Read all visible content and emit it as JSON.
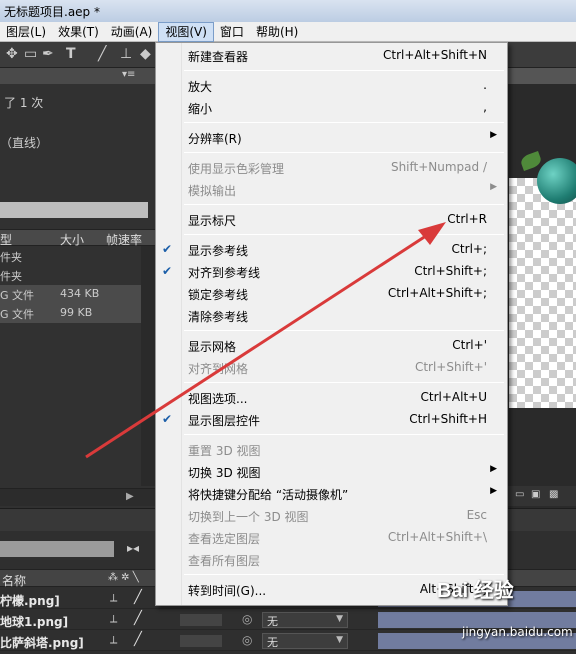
{
  "window": {
    "title": "无标题项目.aep *"
  },
  "menubar": [
    "图层(L)",
    "效果(T)",
    "动画(A)",
    "视图(V)",
    "窗口",
    "帮助(H)"
  ],
  "project": {
    "info_line1": "了 1 次",
    "info_line2": "（直线）",
    "columns": {
      "type": "型",
      "size": "大小",
      "fps": "帧速率"
    },
    "rows": [
      {
        "type": "件夹",
        "size": ""
      },
      {
        "type": "件夹",
        "size": ""
      },
      {
        "type": "G 文件",
        "size": "434 KB"
      },
      {
        "type": "G 文件",
        "size": "99 KB"
      }
    ]
  },
  "view_menu": {
    "items": [
      {
        "label": "新建查看器",
        "shortcut": "Ctrl+Alt+Shift+N",
        "disabled": false,
        "checked": false,
        "submenu": false
      },
      {
        "label": "放大",
        "shortcut": ".",
        "disabled": false,
        "checked": false,
        "submenu": false
      },
      {
        "label": "缩小",
        "shortcut": ",",
        "disabled": false,
        "checked": false,
        "submenu": false
      },
      {
        "label": "分辨率(R)",
        "shortcut": "",
        "disabled": false,
        "checked": false,
        "submenu": true
      },
      {
        "label": "使用显示色彩管理",
        "shortcut": "Shift+Numpad /",
        "disabled": true,
        "checked": false,
        "submenu": false
      },
      {
        "label": "模拟输出",
        "shortcut": "",
        "disabled": true,
        "checked": false,
        "submenu": true
      },
      {
        "label": "显示标尺",
        "shortcut": "Ctrl+R",
        "disabled": false,
        "checked": false,
        "submenu": false
      },
      {
        "label": "显示参考线",
        "shortcut": "Ctrl+;",
        "disabled": false,
        "checked": true,
        "submenu": false
      },
      {
        "label": "对齐到参考线",
        "shortcut": "Ctrl+Shift+;",
        "disabled": false,
        "checked": true,
        "submenu": false
      },
      {
        "label": "锁定参考线",
        "shortcut": "Ctrl+Alt+Shift+;",
        "disabled": false,
        "checked": false,
        "submenu": false
      },
      {
        "label": "清除参考线",
        "shortcut": "",
        "disabled": false,
        "checked": false,
        "submenu": false
      },
      {
        "label": "显示网格",
        "shortcut": "Ctrl+'",
        "disabled": false,
        "checked": false,
        "submenu": false
      },
      {
        "label": "对齐到网格",
        "shortcut": "Ctrl+Shift+'",
        "disabled": true,
        "checked": false,
        "submenu": false
      },
      {
        "label": "视图选项...",
        "shortcut": "Ctrl+Alt+U",
        "disabled": false,
        "checked": false,
        "submenu": false
      },
      {
        "label": "显示图层控件",
        "shortcut": "Ctrl+Shift+H",
        "disabled": false,
        "checked": true,
        "submenu": false
      },
      {
        "label": "重置 3D 视图",
        "shortcut": "",
        "disabled": true,
        "checked": false,
        "submenu": false
      },
      {
        "label": "切换 3D 视图",
        "shortcut": "",
        "disabled": false,
        "checked": false,
        "submenu": true
      },
      {
        "label": "将快捷键分配给 “活动摄像机”",
        "shortcut": "",
        "disabled": false,
        "checked": false,
        "submenu": true
      },
      {
        "label": "切换到上一个 3D 视图",
        "shortcut": "Esc",
        "disabled": true,
        "checked": false,
        "submenu": false
      },
      {
        "label": "查看选定图层",
        "shortcut": "Ctrl+Alt+Shift+\\",
        "disabled": true,
        "checked": false,
        "submenu": false
      },
      {
        "label": "查看所有图层",
        "shortcut": "",
        "disabled": true,
        "checked": false,
        "submenu": false
      },
      {
        "label": "转到时间(G)...",
        "shortcut": "Alt+Shift+J",
        "disabled": false,
        "checked": false,
        "submenu": false
      }
    ]
  },
  "timeline": {
    "col_name": "名称",
    "layers": [
      {
        "name": "柠檬.png]",
        "parent": "无"
      },
      {
        "name": "地球1.png]",
        "parent": "无"
      },
      {
        "name": "比萨斜塔.png]",
        "parent": "无"
      }
    ]
  },
  "watermark": {
    "brand": "Bai 经验",
    "url": "jingyan.baidu.com"
  },
  "colors": {
    "arrow": "#d93a3a",
    "check": "#1b5ea8",
    "menu_bg": "#f0f0f0"
  }
}
